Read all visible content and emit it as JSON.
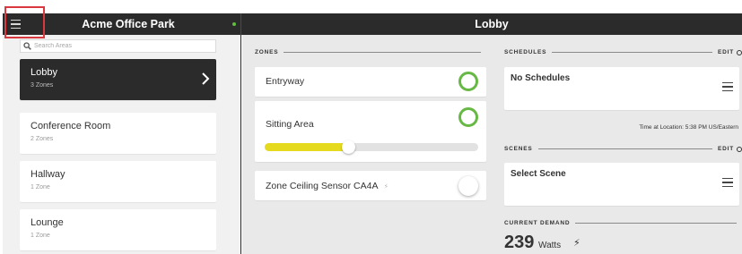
{
  "header": {
    "site_name": "Acme Office Park",
    "page_title": "Lobby",
    "status_color": "#5ec13d"
  },
  "sidebar": {
    "search_placeholder": "Search Areas",
    "areas": [
      {
        "name": "Lobby",
        "zones": "3 Zones",
        "selected": true
      },
      {
        "name": "Conference Room",
        "zones": "2 Zones",
        "selected": false
      },
      {
        "name": "Hallway",
        "zones": "1 Zone",
        "selected": false
      },
      {
        "name": "Lounge",
        "zones": "1 Zone",
        "selected": false
      }
    ]
  },
  "zones_section": {
    "heading": "ZONES",
    "zones": [
      {
        "name": "Entryway",
        "state": "on"
      },
      {
        "name": "Sitting Area",
        "state": "on",
        "level": 0.37
      },
      {
        "name": "Zone Ceiling Sensor CA4A",
        "state": "off",
        "icon": "bolt-icon"
      }
    ]
  },
  "schedules": {
    "heading": "SCHEDULES",
    "edit_label": "EDIT",
    "card_title": "No Schedules"
  },
  "time_note": "Time at Location: 5:38 PM US/Eastern",
  "scenes": {
    "heading": "SCENES",
    "edit_label": "EDIT",
    "card_title": "Select Scene"
  },
  "demand": {
    "heading": "CURRENT DEMAND",
    "value": "239",
    "unit": "Watts"
  },
  "colors": {
    "accent_green": "#67b844",
    "slider_yellow": "#e6da1e",
    "dark_bar": "#2b2b2b",
    "highlight_red": "#d9383f"
  }
}
